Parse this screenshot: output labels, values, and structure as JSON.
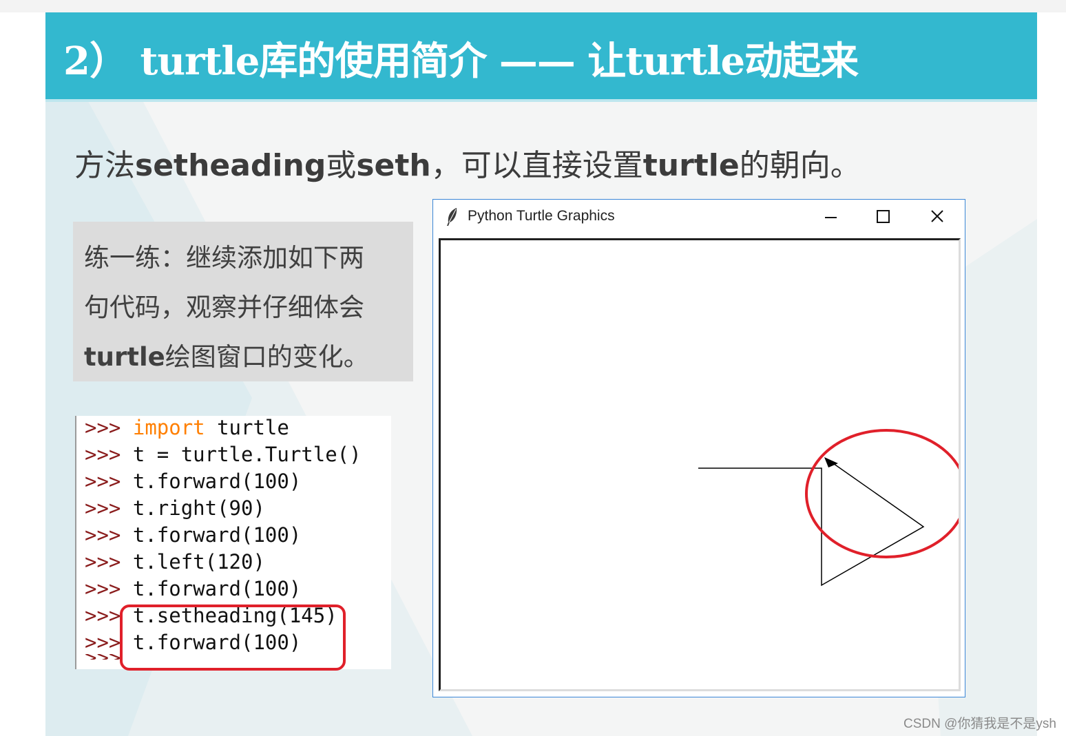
{
  "header": {
    "title": "2） turtle库的使用简介 —— 让turtle动起来"
  },
  "subtitle": {
    "prefix": "方法",
    "method1": "setheading",
    "or": "或",
    "method2": "seth",
    "suffix_a": "，可以直接设置",
    "turtle": "turtle",
    "suffix_b": "的朝向。"
  },
  "exercise": {
    "line1": "练一练：继续添加如下两",
    "line2": "句代码，观察并仔细体会",
    "line3_bold": "turtle",
    "line3_rest": "绘图窗口的变化。"
  },
  "code": {
    "prompt": ">>>",
    "lines": [
      {
        "keyword": "import",
        "text": " turtle"
      },
      {
        "keyword": "",
        "text": "t = turtle.Turtle()"
      },
      {
        "keyword": "",
        "text": "t.forward(100)"
      },
      {
        "keyword": "",
        "text": "t.right(90)"
      },
      {
        "keyword": "",
        "text": "t.forward(100)"
      },
      {
        "keyword": "",
        "text": "t.left(120)"
      },
      {
        "keyword": "",
        "text": "t.forward(100)"
      },
      {
        "keyword": "",
        "text": "t.setheading(145)"
      },
      {
        "keyword": "",
        "text": "t.forward(100)"
      }
    ]
  },
  "turtle_window": {
    "title": "Python Turtle Graphics",
    "app_icon": "feather-icon",
    "buttons": [
      "minimize-icon",
      "maximize-icon",
      "close-icon"
    ]
  },
  "colors": {
    "header_bg": "#33b8cf",
    "highlight": "#e0202a",
    "prompt": "#8a1c1c",
    "keyword": "#ff7f00"
  },
  "watermark": "CSDN @你猜我是不是ysh"
}
